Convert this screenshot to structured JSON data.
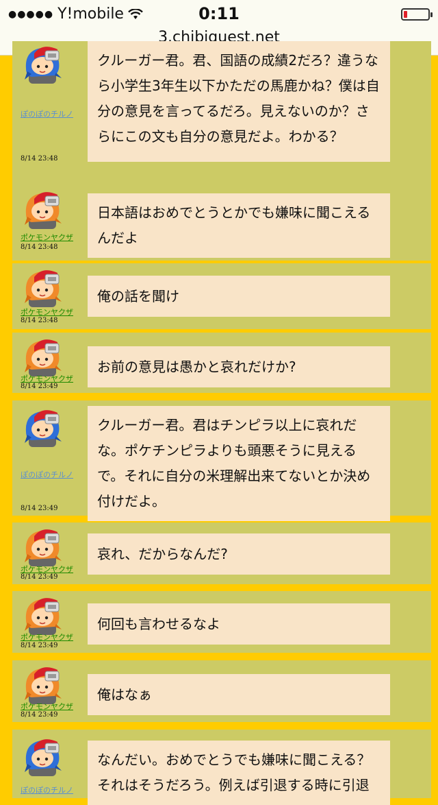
{
  "status_bar": {
    "signal_dots": "●●●●●",
    "carrier": "Y!mobile",
    "time": "0:11",
    "url": "3.chibiquest.net"
  },
  "messages": [
    {
      "name": "ぽのぽのチルノ",
      "name_color": "blue",
      "time": "8/14 23:48",
      "avatar": "blue-hair-avatar",
      "text": "クルーガー君。君、国語の成績2だろ？違うなら小学生3年生以下かただの馬鹿かね？僕は自分の意見を言ってるだろ。見えないのか？さらにこの文も自分の意見だよ。わかる？"
    },
    {
      "name": "ポケモンヤクザ",
      "name_color": "green",
      "time": "8/14 23:48",
      "avatar": "orange-hair-avatar",
      "text": "日本語はおめでとうとかでも嫌味に聞こえるんだよ"
    },
    {
      "name": "ポケモンヤクザ",
      "name_color": "green",
      "time": "8/14 23:48",
      "avatar": "orange-hair-avatar",
      "text": "俺の話を聞け"
    },
    {
      "name": "ポケモンヤクザ",
      "name_color": "green",
      "time": "8/14 23:49",
      "avatar": "orange-hair-avatar",
      "text": "お前の意見は愚かと哀れだけか?"
    },
    {
      "name": "ぽのぽのチルノ",
      "name_color": "blue",
      "time": "8/14 23:49",
      "avatar": "blue-hair-avatar",
      "text": "クルーガー君。君はチンピラ以上に哀れだな。ポケチンピラよりも頭悪そうに見えるで。それに自分の米理解出来てないとか決め付けだよ。"
    },
    {
      "name": "ポケモンヤクザ",
      "name_color": "green",
      "time": "8/14 23:49",
      "avatar": "orange-hair-avatar",
      "text": "哀れ、だからなんだ?"
    },
    {
      "name": "ポケモンヤクザ",
      "name_color": "green",
      "time": "8/14 23:49",
      "avatar": "orange-hair-avatar",
      "text": "何回も言わせるなよ"
    },
    {
      "name": "ポケモンヤクザ",
      "name_color": "green",
      "time": "8/14 23:49",
      "avatar": "orange-hair-avatar",
      "text": "俺はなぁ"
    },
    {
      "name": "ぽのぽのチルノ",
      "name_color": "blue",
      "time": "",
      "avatar": "blue-hair-avatar",
      "text": "なんだい。おめでとうでも嫌味に聞こえる？それはそうだろう。例えば引退する時に引退"
    }
  ],
  "colors": {
    "background": "#ffcc00",
    "message_bg": "#cccb65",
    "bubble_bg": "#f9e4c8",
    "name_green": "#1e8a00",
    "name_blue": "#5b8fd0"
  }
}
